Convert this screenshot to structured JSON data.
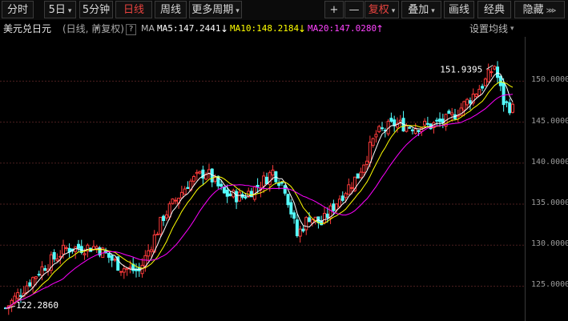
{
  "toolbar": {
    "left": [
      {
        "label": "分时"
      },
      {
        "label": "5日",
        "caret": "▾"
      },
      {
        "label": "5分钟",
        "caret": "▾"
      },
      {
        "label": "日线",
        "active": true
      },
      {
        "label": "周线"
      },
      {
        "label": "更多周期",
        "caret": "▾"
      }
    ],
    "right": [
      {
        "label": "+"
      },
      {
        "label": "—"
      },
      {
        "label": "复权",
        "caret": "▾",
        "red": true
      },
      {
        "label": "叠加",
        "caret": "▾"
      },
      {
        "label": "画线"
      },
      {
        "label": "经典"
      },
      {
        "label": "隐藏",
        "caret": "⋙"
      }
    ]
  },
  "title": {
    "symbol": "美元兑日元",
    "period": "(日线, 前复权)",
    "help": "?",
    "ma_label": "MA",
    "ma5": "MA5:147.2441",
    "ma5_arrow": "↓",
    "ma10": "MA10:148.2184",
    "ma10_arrow": "↓",
    "ma20": "MA20:147.0280",
    "ma20_arrow": "↑",
    "settings": "设置均线",
    "settings_caret": "▾"
  },
  "colors": {
    "up": "#ff3b3b",
    "down": "#54ffff",
    "ma5": "#ffffff",
    "ma10": "#ffff00",
    "ma20": "#ff00ff",
    "grid": "#4b1f1f"
  },
  "axis": {
    "labels": [
      "150.0000",
      "145.0000",
      "140.0000",
      "135.0000",
      "130.0000",
      "125.0000"
    ],
    "values": [
      150,
      145,
      140,
      135,
      130,
      125
    ],
    "ymin": 120.75,
    "ymax": 155.4
  },
  "annotations": {
    "high": "151.9395",
    "low": "122.2860"
  },
  "chart_data": {
    "type": "candlestick",
    "series": [
      "MA5",
      "MA10",
      "MA20"
    ],
    "ma5_last": 147.2441,
    "ma10_last": 148.2184,
    "ma20_last": 147.028,
    "period_high": 151.9395,
    "period_low": 122.286,
    "ylim": [
      120.75,
      155.4
    ]
  }
}
